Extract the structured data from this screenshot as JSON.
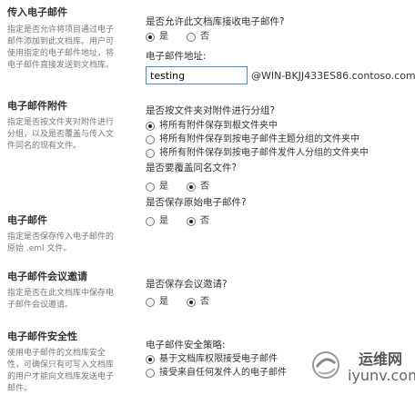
{
  "sections": {
    "incoming": {
      "title": "传入电子邮件",
      "desc": "指定是否允许将项目通过电子邮件添加到此文档库。用户可使用指定的电子邮件地址，将电子邮件直接发送到文档库。",
      "question": "是否允许此文档库接收电子邮件?",
      "options": [
        "是",
        "否"
      ],
      "selected": "是",
      "address_label": "电子邮件地址:",
      "address_value": "testing",
      "address_domain": "@WIN-BKJJ433ES86.contoso.com"
    },
    "attachments": {
      "title": "电子邮件附件",
      "desc": "指定是否按文件夹对附件进行分组，以及是否覆盖与传入文件同名的现有文件。",
      "question": "是否按文件夹对附件进行分组?",
      "group_options": [
        "将所有附件保存到根文件夹中",
        "将所有附件保存到按电子邮件主题分组的文件夹中",
        "将所有附件保存到按电子邮件发件人分组的文件夹中"
      ],
      "group_selected": "将所有附件保存到根文件夹中",
      "overwrite_question": "是否要覆盖同名文件?",
      "overwrite_options": [
        "是",
        "否"
      ],
      "overwrite_selected": "否"
    },
    "email": {
      "title": "电子邮件",
      "desc": "指定是否保存传入电子邮件的原始 .eml 文件。",
      "question": "是否保存原始电子邮件?",
      "options": [
        "是",
        "否"
      ],
      "selected": "否"
    },
    "meeting": {
      "title": "电子邮件会议邀请",
      "desc": "指定是否在此文档库中保存电子邮件会议邀请。",
      "question": "是否保存会议邀请?",
      "options": [
        "是",
        "否"
      ],
      "selected": "否"
    },
    "security": {
      "title": "电子邮件安全性",
      "desc": "使用电子邮件的文档库安全性，可确保只有可写入文档库的用户才能向文档库发送电子邮件。",
      "question": "电子邮件安全策略:",
      "options": [
        "基于文档库权限接受电子邮件",
        "接受来自任何发件人的电子邮件"
      ],
      "selected": "基于文档库权限接受电子邮件"
    }
  },
  "watermark": {
    "line1": "运维网",
    "line2": "iyunv.com"
  }
}
